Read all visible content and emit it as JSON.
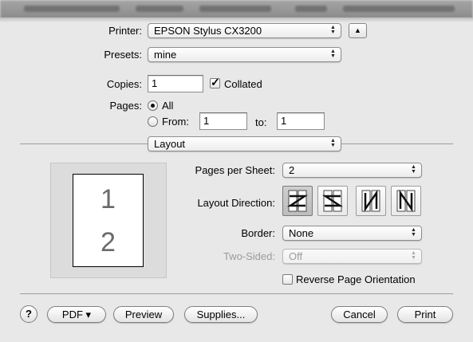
{
  "window": {
    "title_blurred": true
  },
  "printer": {
    "label": "Printer:",
    "value": "EPSON Stylus CX3200"
  },
  "presets": {
    "label": "Presets:",
    "value": "mine"
  },
  "copies": {
    "label": "Copies:",
    "value": "1",
    "collated_label": "Collated",
    "collated": true
  },
  "pages": {
    "label": "Pages:",
    "all_label": "All",
    "from_label": "From:",
    "from_value": "1",
    "to_label": "to:",
    "to_value": "1",
    "selected": "All"
  },
  "panel_menu": {
    "value": "Layout"
  },
  "layout": {
    "pages_per_sheet_label": "Pages per Sheet:",
    "pages_per_sheet_value": "2",
    "layout_direction_label": "Layout Direction:",
    "directions": [
      "Z",
      "S",
      "N",
      "N"
    ],
    "selected_direction": 0,
    "border_label": "Border:",
    "border_value": "None",
    "two_sided_label": "Two-Sided:",
    "two_sided_value": "Off",
    "reverse_label": "Reverse Page Orientation",
    "reverse_checked": false
  },
  "preview": {
    "page1": "1",
    "page2": "2"
  },
  "buttons": {
    "help": "?",
    "pdf": "PDF ▾",
    "preview": "Preview",
    "supplies": "Supplies...",
    "cancel": "Cancel",
    "print": "Print"
  },
  "icons": {
    "disclosure": "triangle-up-icon",
    "popup_arrows": "updown-arrows-icon"
  }
}
